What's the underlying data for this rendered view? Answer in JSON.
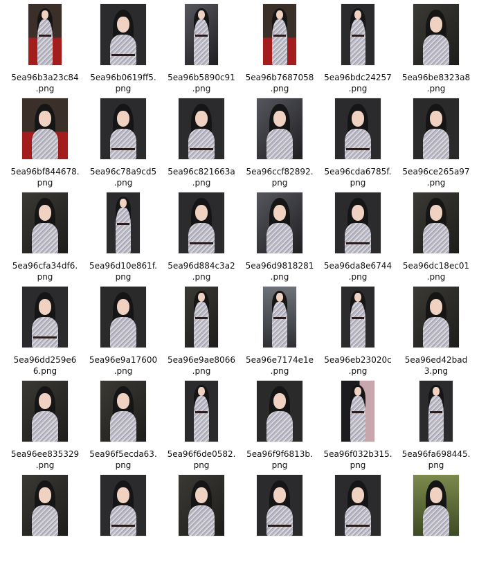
{
  "files": [
    {
      "line1": "5ea96b3a23c84",
      "line2": ".png",
      "shape": "tall",
      "scene": "red"
    },
    {
      "line1": "5ea96b0619ff5.",
      "line2": "png",
      "shape": "wide",
      "scene": "dark"
    },
    {
      "line1": "5ea96b5890c91",
      "line2": ".png",
      "shape": "tall",
      "scene": "cbs"
    },
    {
      "line1": "5ea96b7687058",
      "line2": ".png",
      "shape": "tall",
      "scene": "red"
    },
    {
      "line1": "5ea96bdc24257",
      "line2": ".png",
      "shape": "tall",
      "scene": "dark"
    },
    {
      "line1": "5ea96be8323a8",
      "line2": ".png",
      "shape": "wide",
      "scene": "hfa"
    },
    {
      "line1": "5ea96bf844678.",
      "line2": "png",
      "shape": "wide",
      "scene": "red"
    },
    {
      "line1": "5ea96c78a9cd5",
      "line2": ".png",
      "shape": "wide",
      "scene": "dark"
    },
    {
      "line1": "5ea96c821663a",
      "line2": ".png",
      "shape": "wide",
      "scene": "dark"
    },
    {
      "line1": "5ea96ccf82892.",
      "line2": "png",
      "shape": "wide",
      "scene": "cbs"
    },
    {
      "line1": "5ea96cda6785f.",
      "line2": "png",
      "shape": "wide",
      "scene": "dark"
    },
    {
      "line1": "5ea96ce265a97",
      "line2": ".png",
      "shape": "wide",
      "scene": "close"
    },
    {
      "line1": "5ea96cfa34df6.",
      "line2": "png",
      "shape": "wide",
      "scene": "hfa"
    },
    {
      "line1": "5ea96d10e861f.",
      "line2": "png",
      "shape": "tall",
      "scene": "dark"
    },
    {
      "line1": "5ea96d884c3a2",
      "line2": ".png",
      "shape": "wide",
      "scene": "dark"
    },
    {
      "line1": "5ea96d9818281",
      "line2": ".png",
      "shape": "wide",
      "scene": "cbs"
    },
    {
      "line1": "5ea96da8e6744",
      "line2": ".png",
      "shape": "wide",
      "scene": "dark"
    },
    {
      "line1": "5ea96dc18ec01",
      "line2": ".png",
      "shape": "wide",
      "scene": "hfa"
    },
    {
      "line1": "5ea96dd259e6",
      "line2": "6.png",
      "shape": "wide",
      "scene": "dark"
    },
    {
      "line1": "5ea96e9a17600",
      "line2": ".png",
      "shape": "wide",
      "scene": "close"
    },
    {
      "line1": "5ea96e9ae8066",
      "line2": ".png",
      "shape": "tall",
      "scene": "hfa"
    },
    {
      "line1": "5ea96e7174e1e",
      "line2": ".png",
      "shape": "tall",
      "scene": "crowd"
    },
    {
      "line1": "5ea96eb23020c",
      "line2": ".png",
      "shape": "tall",
      "scene": "dark"
    },
    {
      "line1": "5ea96ed42bad",
      "line2": "3.png",
      "shape": "wide",
      "scene": "hfa"
    },
    {
      "line1": "5ea96ee835329",
      "line2": ".png",
      "shape": "wide",
      "scene": "hfa"
    },
    {
      "line1": "5ea96f5ecda63.",
      "line2": "png",
      "shape": "wide",
      "scene": "hfa"
    },
    {
      "line1": "5ea96f6de0582.",
      "line2": "png",
      "shape": "tall",
      "scene": "dark"
    },
    {
      "line1": "5ea96f9f6813b.",
      "line2": "png",
      "shape": "wide",
      "scene": "close"
    },
    {
      "line1": "5ea96f032b315.",
      "line2": "png",
      "shape": "tall",
      "scene": "clutch"
    },
    {
      "line1": "5ea96fa698445.",
      "line2": "png",
      "shape": "tall",
      "scene": "dark"
    },
    {
      "line1": "",
      "line2": "",
      "shape": "wide",
      "scene": "hfa"
    },
    {
      "line1": "",
      "line2": "",
      "shape": "wide",
      "scene": "dark"
    },
    {
      "line1": "",
      "line2": "",
      "shape": "wide",
      "scene": "hfa"
    },
    {
      "line1": "",
      "line2": "",
      "shape": "wide",
      "scene": "dark"
    },
    {
      "line1": "",
      "line2": "",
      "shape": "wide",
      "scene": "dark"
    },
    {
      "line1": "",
      "line2": "",
      "shape": "wide",
      "scene": "outdoor"
    }
  ],
  "scene_colors": {
    "red": "#5a2a28",
    "dark": "#2b2b2e",
    "cbs": "#3a3a3f",
    "hfa": "#3b3a36",
    "close": "#2a2a2a",
    "crowd": "#4a4d52",
    "clutch": "#2c2b30",
    "outdoor": "#5d6a3a"
  }
}
